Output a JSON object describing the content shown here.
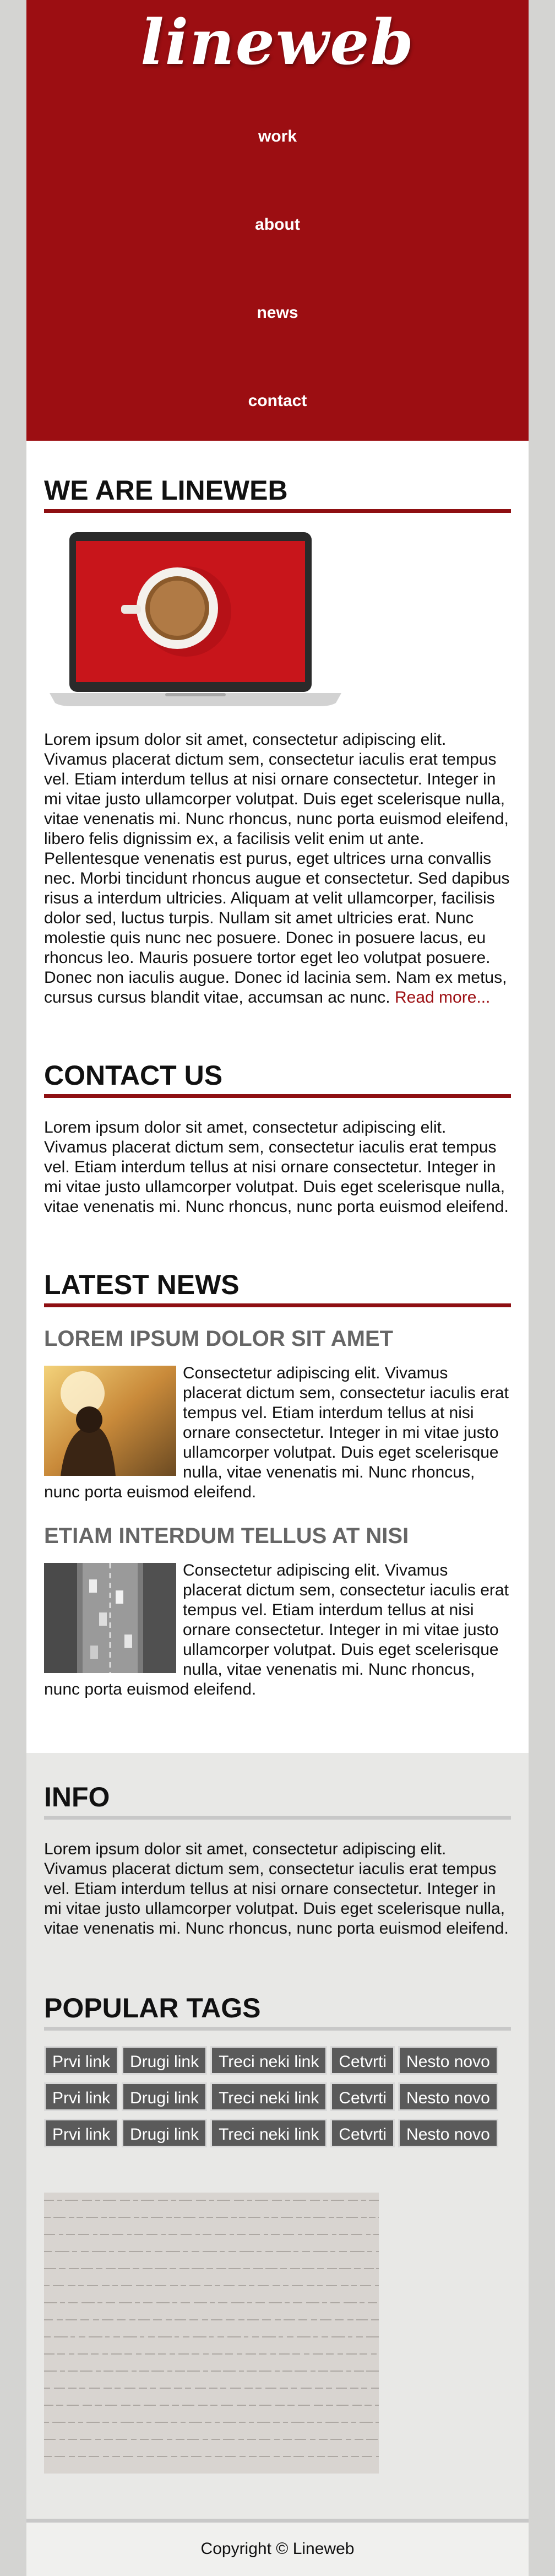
{
  "header": {
    "logo": "lineweb",
    "nav": [
      "work",
      "about",
      "news",
      "contact"
    ]
  },
  "about": {
    "title": "WE ARE LINEWEB",
    "text": "Lorem ipsum dolor sit amet, consectetur adipiscing elit. Vivamus placerat dictum sem, consectetur iaculis erat tempus vel. Etiam interdum tellus at nisi ornare consectetur. Integer in mi vitae justo ullamcorper volutpat. Duis eget scelerisque nulla, vitae venenatis mi. Nunc rhoncus, nunc porta euismod eleifend, libero felis dignissim ex, a facilisis velit enim ut ante. Pellentesque venenatis est purus, eget ultrices urna convallis nec. Morbi tincidunt rhoncus augue et consectetur. Sed dapibus risus a interdum ultricies. Aliquam at velit ullamcorper, facilisis dolor sed, luctus turpis. Nullam sit amet ultricies erat. Nunc molestie quis nunc nec posuere. Donec in posuere lacus, eu rhoncus leo. Mauris posuere tortor eget leo volutpat posuere. Donec non iaculis augue. Donec id lacinia sem. Nam ex metus, cursus cursus blandit vitae, accumsan ac nunc. ",
    "read_more": "Read more..."
  },
  "contact": {
    "title": "CONTACT US",
    "text": "Lorem ipsum dolor sit amet, consectetur adipiscing elit. Vivamus placerat dictum sem, consectetur iaculis erat tempus vel. Etiam interdum tellus at nisi ornare consectetur. Integer in mi vitae justo ullamcorper volutpat. Duis eget scelerisque nulla, vitae venenatis mi. Nunc rhoncus, nunc porta euismod eleifend."
  },
  "news": {
    "title": "LATEST NEWS",
    "items": [
      {
        "title": "LOREM IPSUM DOLOR SIT AMET",
        "text": "Consectetur adipiscing elit. Vivamus placerat dictum sem, consectetur iaculis erat tempus vel. Etiam interdum tellus at nisi ornare consectetur. Integer in mi vitae justo ullamcorper volutpat. Duis eget scelerisque nulla, vitae venenatis mi. Nunc rhoncus, nunc porta euismod eleifend."
      },
      {
        "title": "ETIAM INTERDUM TELLUS AT NISI",
        "text": "Consectetur adipiscing elit. Vivamus placerat dictum sem, consectetur iaculis erat tempus vel. Etiam interdum tellus at nisi ornare consectetur. Integer in mi vitae justo ullamcorper volutpat. Duis eget scelerisque nulla, vitae venenatis mi. Nunc rhoncus, nunc porta euismod eleifend."
      }
    ]
  },
  "info": {
    "title": "INFO",
    "text": "Lorem ipsum dolor sit amet, consectetur adipiscing elit. Vivamus placerat dictum sem, consectetur iaculis erat tempus vel. Etiam interdum tellus at nisi ornare consectetur. Integer in mi vitae justo ullamcorper volutpat. Duis eget scelerisque nulla, vitae venenatis mi. Nunc rhoncus, nunc porta euismod eleifend."
  },
  "tags": {
    "title": "POPULAR TAGS",
    "rows": [
      [
        "Prvi link",
        "Drugi link",
        "Treci neki link",
        "Cetvrti",
        "Nesto novo"
      ],
      [
        "Prvi link",
        "Drugi link",
        "Treci neki link",
        "Cetvrti",
        "Nesto novo"
      ],
      [
        "Prvi link",
        "Drugi link",
        "Treci neki link",
        "Cetvrti",
        "Nesto novo"
      ]
    ]
  },
  "footer": {
    "copyright": "Copyright © Lineweb"
  },
  "colors": {
    "brand": "#9c0e12",
    "page_bg": "#d4d4d2",
    "tag_bg": "#5a5a5a"
  }
}
